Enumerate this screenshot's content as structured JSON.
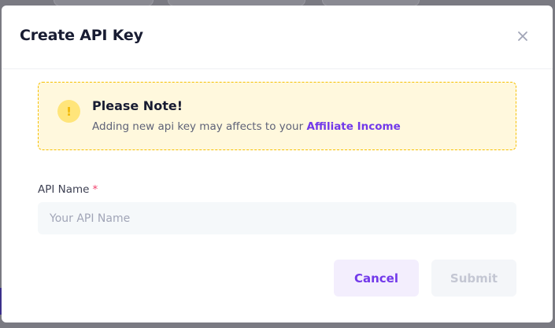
{
  "modal": {
    "title": "Create API Key",
    "close_icon": "close-icon"
  },
  "notice": {
    "icon": "warning-exclamation-icon",
    "icon_glyph": "!",
    "title": "Please Note!",
    "text": "Adding new api key may affects to your",
    "link_text": "Affiliate Income"
  },
  "form": {
    "api_name_label": "API Name",
    "required_mark": "*",
    "api_name_placeholder": "Your API Name",
    "api_name_value": ""
  },
  "actions": {
    "cancel_label": "Cancel",
    "submit_label": "Submit"
  },
  "colors": {
    "accent": "#7239ea",
    "warning_bg": "#fff8dd",
    "warning_border": "#f6c000",
    "required": "#f1416c"
  }
}
